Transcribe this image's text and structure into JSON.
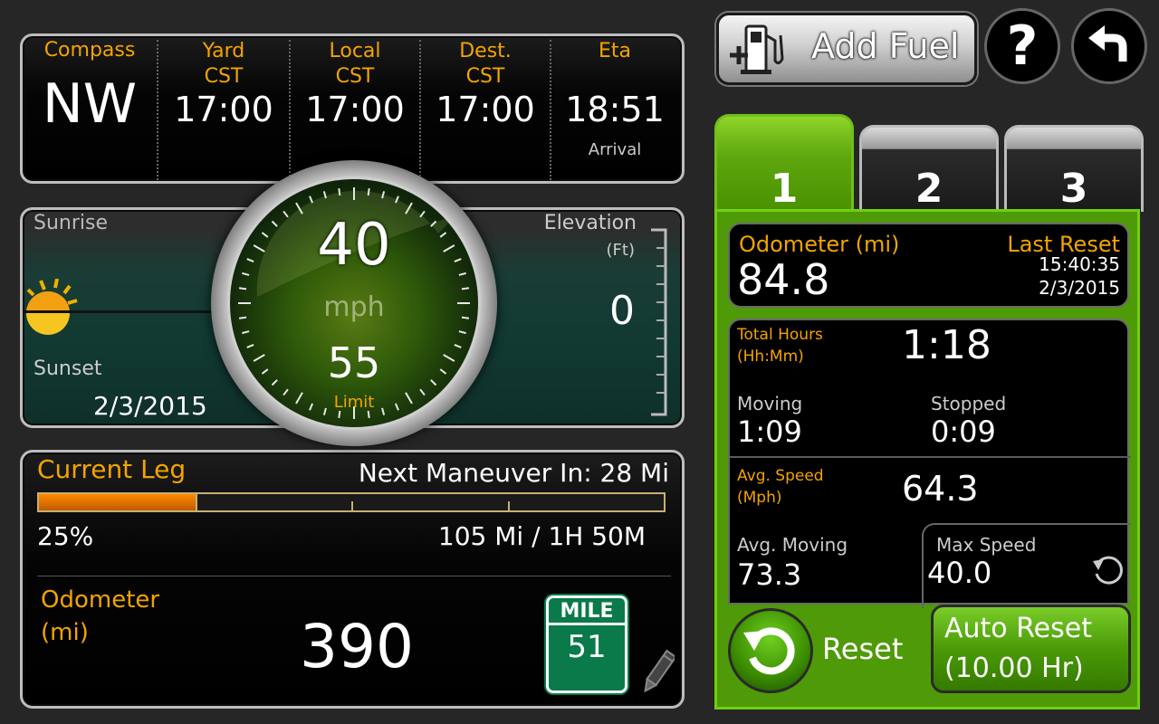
{
  "topbar": {
    "compass": {
      "label": "Compass",
      "value": "NW"
    },
    "yard": {
      "label": "Yard",
      "tz": "CST",
      "value": "17:00"
    },
    "local": {
      "label": "Local",
      "tz": "CST",
      "value": "17:00"
    },
    "dest": {
      "label": "Dest.",
      "tz": "CST",
      "value": "17:00"
    },
    "eta": {
      "label": "Eta",
      "value": "18:51",
      "sub": "Arrival"
    }
  },
  "astro": {
    "sunrise_label": "Sunrise",
    "sunset_label": "Sunset",
    "date": "2/3/2015",
    "elevation_label": "Elevation",
    "elevation_unit": "(Ft)",
    "elevation_value": "0"
  },
  "speedometer": {
    "speed": "40",
    "unit": "mph",
    "limit": "55",
    "limit_label": "Limit"
  },
  "leg": {
    "title": "Current Leg",
    "next_maneuver": "Next Maneuver In: 28 Mi",
    "progress_pct": 25,
    "progress_text": "25%",
    "remaining": "105 Mi / 1H 50M",
    "odometer_label_1": "Odometer",
    "odometer_label_2": "(mi)",
    "odometer_value": "390",
    "mile_marker_label": "MILE",
    "mile_marker_value": "51"
  },
  "actions": {
    "add_fuel": "Add Fuel",
    "help": "?"
  },
  "tabs": [
    "1",
    "2",
    "3"
  ],
  "trip": {
    "odometer_label": "Odometer (mi)",
    "odometer_value": "84.8",
    "last_reset_label": "Last Reset",
    "last_reset_time": "15:40:35",
    "last_reset_date": "2/3/2015",
    "total_hours_label_1": "Total Hours",
    "total_hours_label_2": "(Hh:Mm)",
    "total_hours_value": "1:18",
    "moving_label": "Moving",
    "moving_value": "1:09",
    "stopped_label": "Stopped",
    "stopped_value": "0:09",
    "avg_speed_label_1": "Avg. Speed",
    "avg_speed_label_2": "(Mph)",
    "avg_speed_value": "64.3",
    "avg_moving_label": "Avg. Moving",
    "avg_moving_value": "73.3",
    "max_speed_label": "Max Speed",
    "max_speed_value": "40.0",
    "reset_label": "Reset",
    "auto_reset_label": "Auto Reset",
    "auto_reset_value": "(10.00 Hr)"
  },
  "colors": {
    "accent_orange": "#f3a400",
    "green": "#4f9a08",
    "progress": "#e07400"
  }
}
